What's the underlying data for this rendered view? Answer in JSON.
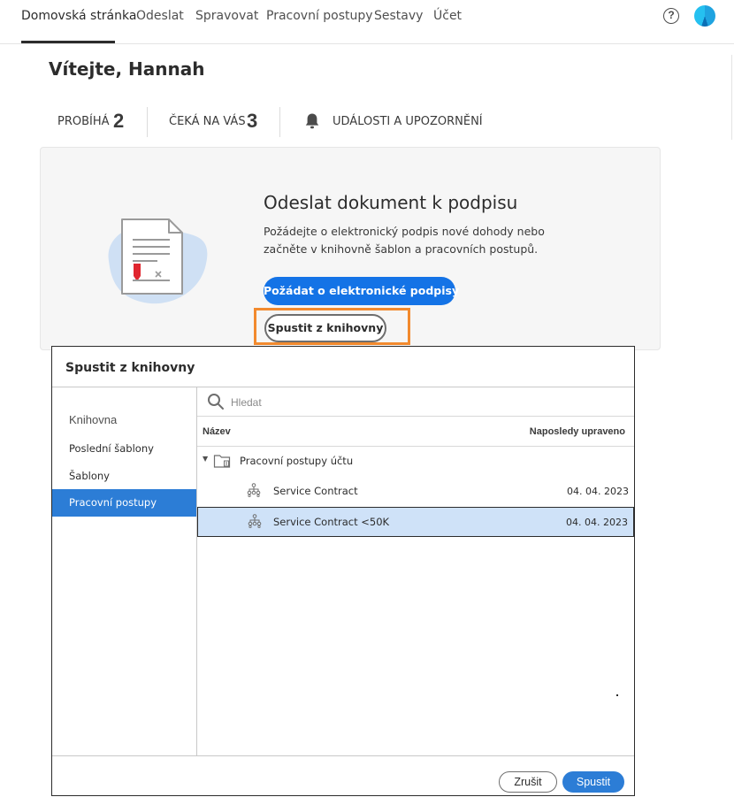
{
  "nav": {
    "items": [
      {
        "label": "Domovská stránka"
      },
      {
        "label": "Odeslat"
      },
      {
        "label": "Spravovat"
      },
      {
        "label": "Pracovní postupy"
      },
      {
        "label": "Sestavy"
      },
      {
        "label": "Účet"
      }
    ],
    "active_index": 0,
    "help_glyph": "?"
  },
  "welcome": "Vítejte, Hannah",
  "stats": {
    "in_progress": {
      "label": "PROBÍHÁ",
      "count": "2"
    },
    "waiting": {
      "label": "ČEKÁ NA VÁS",
      "count": "3"
    },
    "events": {
      "label": "UDÁLOSTI A UPOZORNĚNÍ"
    }
  },
  "card": {
    "title": "Odeslat dokument k podpisu",
    "description": "Požádejte o elektronický podpis nové dohody nebo začněte v knihovně šablon a pracovních postupů.",
    "request_button": "Požádat o elektronické podpisy",
    "library_button": "Spustit z knihovny"
  },
  "dialog": {
    "title": "Spustit z knihovny",
    "sidebar": {
      "heading": "Knihovna",
      "items": [
        {
          "label": "Poslední šablony"
        },
        {
          "label": "Šablony"
        },
        {
          "label": "Pracovní postupy"
        }
      ],
      "active_index": 2
    },
    "search": {
      "placeholder": "Hledat",
      "value": ""
    },
    "columns": {
      "name": "Název",
      "modified": "Naposledy upraveno"
    },
    "folder": {
      "label": "Pracovní postupy účtu",
      "expanded": true
    },
    "rows": [
      {
        "name": "Service Contract",
        "modified": "04. 04. 2023",
        "selected": false
      },
      {
        "name": "Service Contract <50K",
        "modified": "04. 04. 2023",
        "selected": true
      }
    ],
    "cancel_button": "Zrušit",
    "start_button": "Spustit"
  },
  "colors": {
    "primary_blue": "#1473e6",
    "selection_blue": "#2c7dd6",
    "row_selected": "#cfe2f8",
    "highlight_orange": "#f28a2e"
  },
  "icons": [
    "help-icon",
    "avatar",
    "bell-icon",
    "document-icon",
    "search-icon",
    "caret-down-icon",
    "folder-icon",
    "workflow-icon"
  ]
}
